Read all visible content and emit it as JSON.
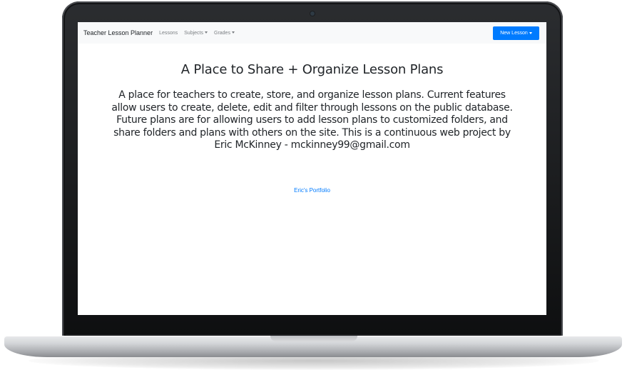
{
  "navbar": {
    "brand": "Teacher Lesson Planner",
    "links": [
      {
        "label": "Lessons"
      },
      {
        "label": "Subjects"
      },
      {
        "label": "Grades"
      }
    ],
    "new_lesson_label": "New Lesson"
  },
  "hero": {
    "title": "A Place to Share + Organize Lesson Plans",
    "description": "A place for teachers to create, store, and organize lesson plans. Current features allow users to create, delete, edit and filter through lessons on the public database. Future plans are for allowing users to add lesson plans to customized folders, and share folders and plans with others on the site. This is a continuous web project by Eric McKinney - mckinney99@gmail.com",
    "portfolio_link": "Eric's Portfolio"
  },
  "colors": {
    "primary": "#007bff",
    "navbar_bg": "#f8f9fa",
    "text": "#212529"
  }
}
